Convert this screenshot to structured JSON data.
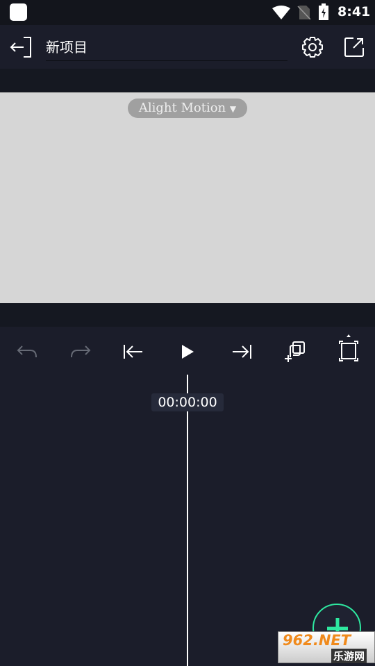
{
  "status_bar": {
    "time": "8:41",
    "icons": [
      "app-icon",
      "wifi-icon",
      "no-sim-icon",
      "battery-charging-icon"
    ]
  },
  "header": {
    "project_title": "新项目",
    "icons": [
      "exit-icon",
      "settings-icon",
      "export-icon"
    ]
  },
  "preview": {
    "watermark_label": "Alight Motion"
  },
  "toolbar": {
    "icons": [
      "undo-icon",
      "redo-icon",
      "skip-to-start-icon",
      "play-icon",
      "skip-to-end-icon",
      "add-layer-icon",
      "fit-screen-icon"
    ]
  },
  "timeline": {
    "timecode": "00:00:00"
  },
  "fab": {
    "icon": "plus-icon",
    "color": "#2ee8a0"
  },
  "site_watermark": {
    "brand": "962.NET",
    "sub": "乐游网"
  }
}
